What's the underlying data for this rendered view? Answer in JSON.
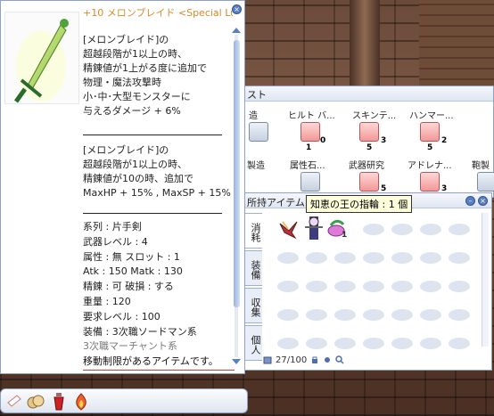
{
  "item": {
    "title": "+10 メロンブレイド <Special Luk...",
    "desc_block1": [
      "[メロンブレイド]の",
      "超越段階が1以上の時、",
      "精錬値が1上がる度に追加で",
      "物理・魔法攻撃時",
      "小･中･大型モンスターに",
      "与えるダメージ + 6%"
    ],
    "desc_block2": [
      "[メロンブレイド]の",
      "超越段階が1以上の時、",
      "精錬値が10の時、追加で",
      "MaxHP + 15% , MaxSP + 15%"
    ],
    "props": [
      "系列 : 片手剣",
      "武器レベル : 4",
      "属性 : 無 スロット : 1",
      "Atk : 150 Matk : 130",
      "精錬 : 可 破損 : する",
      "重量 : 120",
      "要求レベル : 100",
      "装備 : 3次職ソードマン系"
    ],
    "props_gray": "3次職マーチャント系",
    "warning": "移動制限があるアイテムです。"
  },
  "skills": {
    "title_fragment": "スト",
    "row1": [
      {
        "label": "造",
        "level": ""
      },
      {
        "label": "ヒルト バ...",
        "level": "1"
      },
      {
        "label": "スキンテ...",
        "level": "5"
      },
      {
        "label": "ハンマー...",
        "level": "5"
      }
    ],
    "row1_badges": [
      "0",
      "3",
      "2"
    ],
    "row2": [
      {
        "label": "製造"
      },
      {
        "label": "属性石..."
      },
      {
        "label": "武器研究"
      },
      {
        "label": "アドレナ..."
      },
      {
        "label": "鞄製"
      }
    ],
    "row2_badges": [
      "5",
      "3"
    ]
  },
  "inventory": {
    "title": "所持アイテム",
    "tabs": [
      "消耗",
      "装備",
      "収集",
      "個人"
    ],
    "count": "27/100",
    "item_badge": "1",
    "tooltip": "知恵の王の指輪 : 1 個"
  },
  "icons": [
    "sword-icon",
    "close-icon",
    "minimize-icon",
    "search-icon",
    "lock-icon",
    "bag-icon"
  ]
}
